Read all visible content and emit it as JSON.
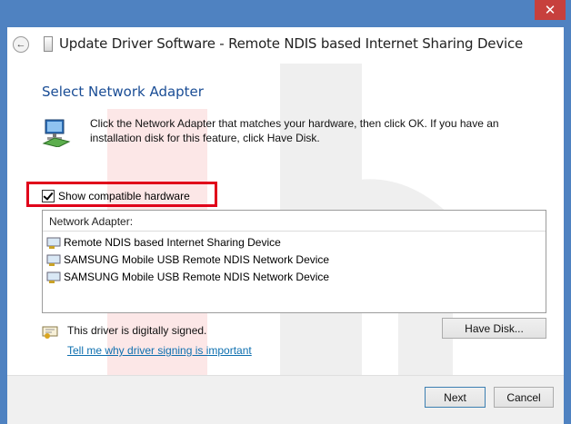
{
  "window": {
    "title": "Update Driver Software - Remote NDIS based Internet Sharing Device",
    "close_symbol": "✕"
  },
  "page": {
    "section_title": "Select Network Adapter",
    "instruction": "Click the Network Adapter that matches your hardware, then click OK. If you have an installation disk for this feature, click Have Disk."
  },
  "compat": {
    "label": "Show compatible hardware",
    "checked": true
  },
  "list": {
    "header": "Network Adapter:",
    "items": [
      "Remote NDIS based Internet Sharing Device",
      "SAMSUNG Mobile USB Remote NDIS Network Device",
      "SAMSUNG Mobile USB Remote NDIS Network Device"
    ]
  },
  "signing": {
    "status": "This driver is digitally signed.",
    "link": "Tell me why driver signing is important"
  },
  "buttons": {
    "have_disk": "Have Disk...",
    "next": "Next",
    "cancel": "Cancel"
  },
  "icons": {
    "back": "back-arrow-icon",
    "window": "window-app-icon",
    "network": "network-adapter-icon",
    "device": "device-driver-icon",
    "certificate": "certificate-icon"
  },
  "colors": {
    "titlebar": "#4f82c1",
    "close": "#c7403d",
    "heading": "#1a4d95",
    "link": "#0d6faf",
    "highlight": "#e0001a"
  }
}
